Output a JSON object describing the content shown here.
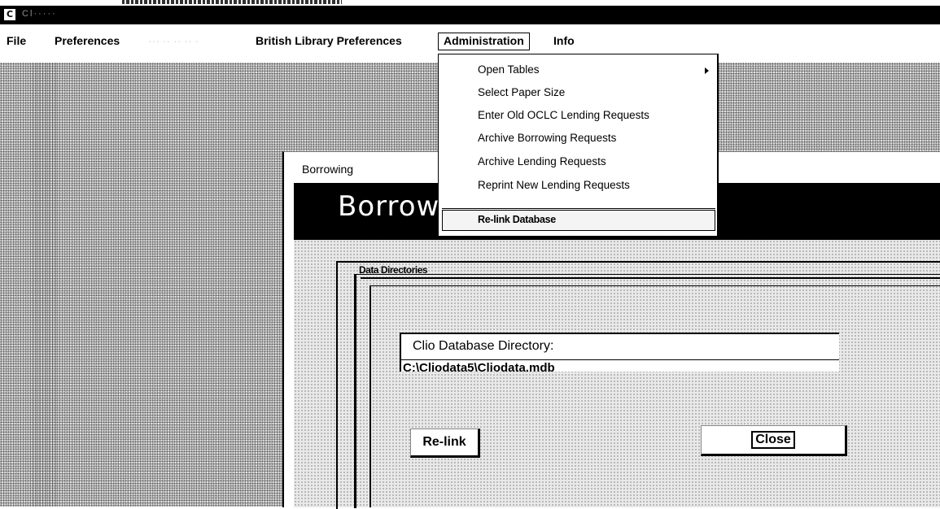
{
  "window": {
    "title": "Cl·····"
  },
  "menubar": {
    "items": [
      {
        "label": "File"
      },
      {
        "label": "Preferences"
      },
      {
        "label": "··· ·· ·· ·· ·"
      },
      {
        "label": "British Library Preferences"
      },
      {
        "label": "Administration"
      },
      {
        "label": "Info"
      }
    ]
  },
  "admin_menu": {
    "items": [
      {
        "label": "Open Tables",
        "has_submenu": true
      },
      {
        "label": "Select Paper Size"
      },
      {
        "label": "Enter Old OCLC Lending Requests"
      },
      {
        "label": "Archive Borrowing Requests"
      },
      {
        "label": "Archive Lending Requests"
      },
      {
        "label": "Reprint New Lending Requests"
      },
      {
        "label": "Re-link Database",
        "selected": true
      }
    ]
  },
  "borrowing_window": {
    "title": "Borrowing",
    "header_text": "Borrowi",
    "group_label": "Data Directories",
    "dir_label": "Clio Database Directory:",
    "dir_value": "C:\\Cliodata5\\Cliodata.mdb",
    "relink_button": "Re-link",
    "close_button": "Close"
  },
  "colors": {
    "titlebar": "#000000",
    "desktop": "#c9c9c9",
    "menu_bg": "#ffffff"
  }
}
